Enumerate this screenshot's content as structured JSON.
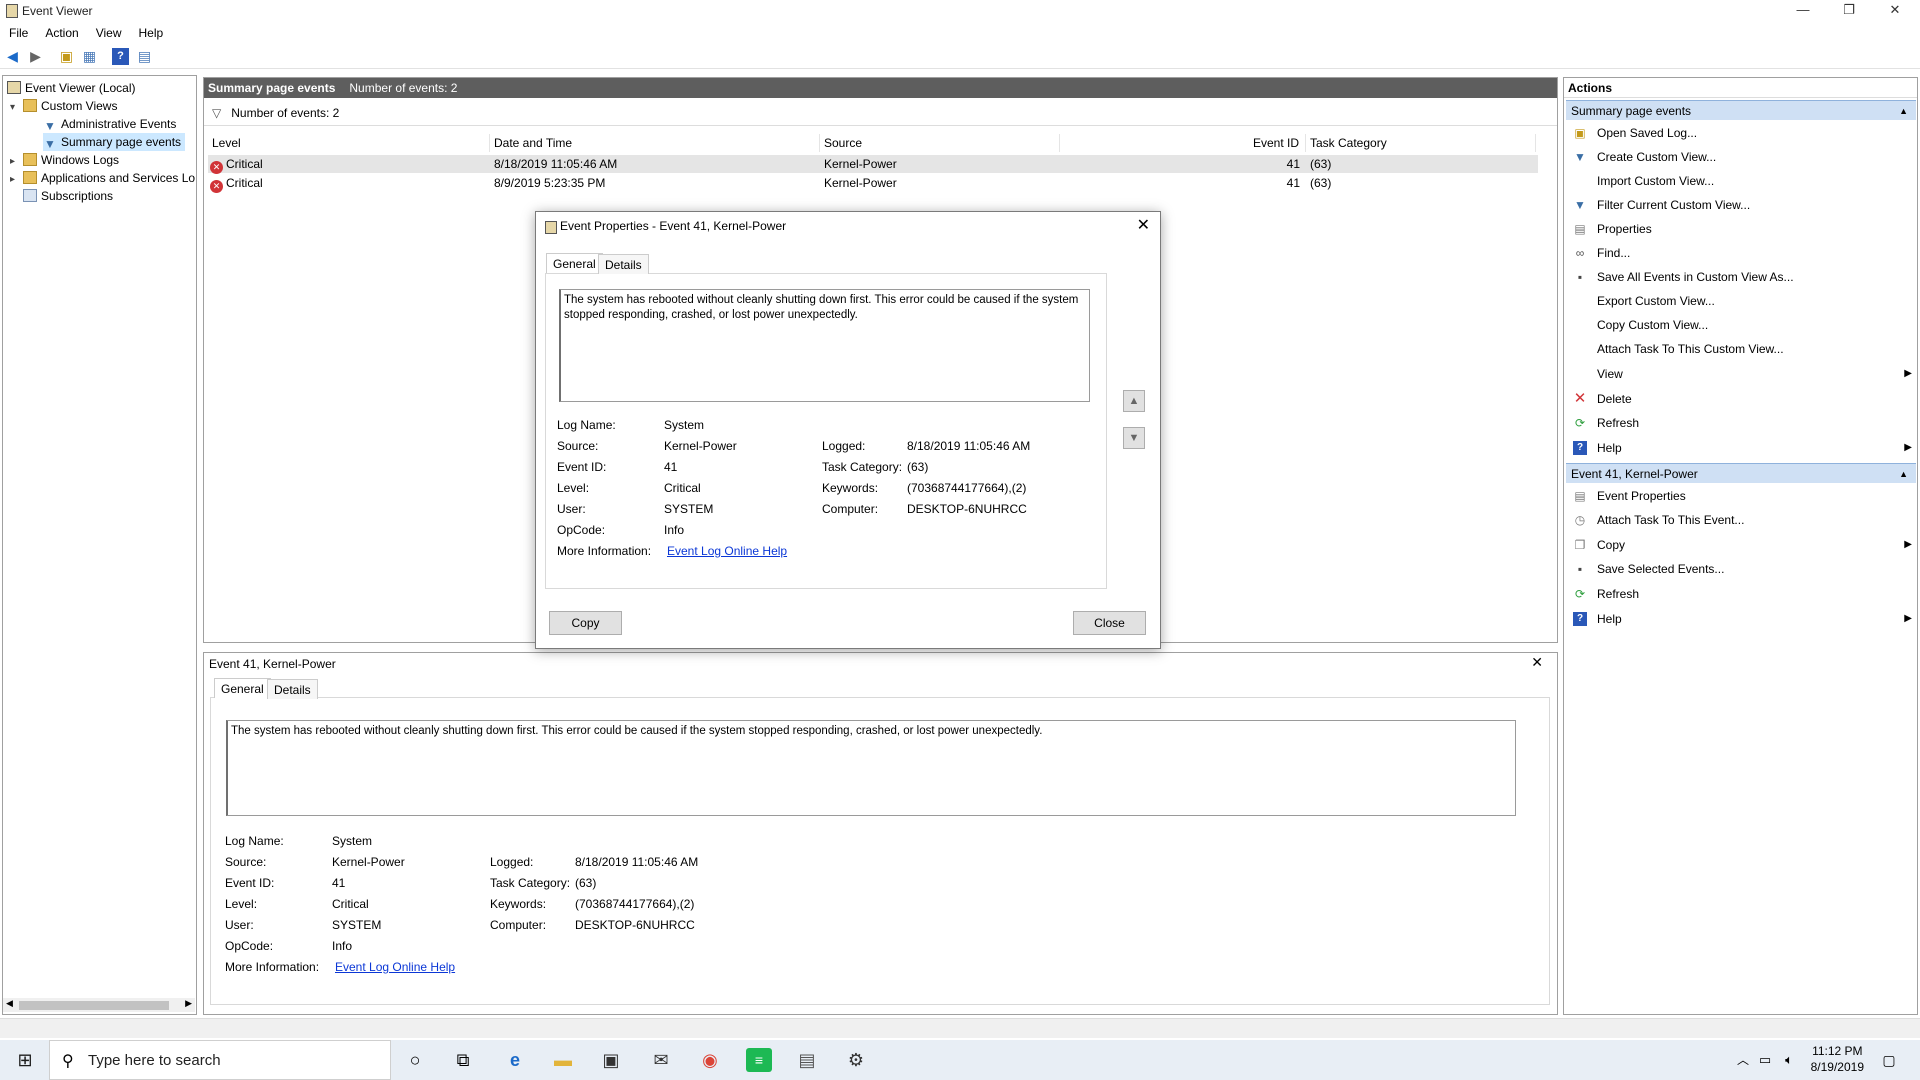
{
  "window": {
    "title": "Event Viewer"
  },
  "menu": [
    "File",
    "Action",
    "View",
    "Help"
  ],
  "tree": {
    "root": "Event Viewer (Local)",
    "custom_views": "Custom Views",
    "admin_events": "Administrative Events",
    "summary_events": "Summary page events",
    "windows_logs": "Windows Logs",
    "app_services": "Applications and Services Lo",
    "subscriptions": "Subscriptions"
  },
  "center": {
    "header_title": "Summary page events",
    "header_count": "Number of events: 2",
    "filter_text": "Number of events: 2",
    "columns": [
      "Level",
      "Date and Time",
      "Source",
      "Event ID",
      "Task Category"
    ],
    "rows": [
      {
        "level": "Critical",
        "datetime": "8/18/2019 11:05:46 AM",
        "source": "Kernel-Power",
        "event_id": "41",
        "task": "(63)"
      },
      {
        "level": "Critical",
        "datetime": "8/9/2019 5:23:35 PM",
        "source": "Kernel-Power",
        "event_id": "41",
        "task": "(63)"
      }
    ]
  },
  "event": {
    "description": "The system has rebooted without cleanly shutting down first. This error could be caused if the system stopped responding, crashed, or lost power unexpectedly.",
    "labels": {
      "log_name": "Log Name:",
      "source": "Source:",
      "event_id": "Event ID:",
      "level": "Level:",
      "user": "User:",
      "opcode": "OpCode:",
      "more_info": "More Information:",
      "logged": "Logged:",
      "task_category": "Task Category:",
      "keywords": "Keywords:",
      "computer": "Computer:"
    },
    "values": {
      "log_name": "System",
      "source": "Kernel-Power",
      "event_id": "41",
      "level": "Critical",
      "user": "SYSTEM",
      "opcode": "Info",
      "more_info_link": "Event Log Online Help",
      "logged": "8/18/2019 11:05:46 AM",
      "task_category": "(63)",
      "keywords": "(70368744177664),(2)",
      "computer": "DESKTOP-6NUHRCC"
    }
  },
  "dialog": {
    "title": "Event Properties - Event 41, Kernel-Power",
    "tab_general": "General",
    "tab_details": "Details",
    "copy_button": "Copy",
    "close_button": "Close"
  },
  "preview": {
    "title": "Event 41, Kernel-Power",
    "tab_general": "General",
    "tab_details": "Details"
  },
  "actions": {
    "title": "Actions",
    "section1": "Summary page events",
    "items1": [
      "Open Saved Log...",
      "Create Custom View...",
      "Import Custom View...",
      "Filter Current Custom View...",
      "Properties",
      "Find...",
      "Save All Events in Custom View As...",
      "Export Custom View...",
      "Copy Custom View...",
      "Attach Task To This Custom View...",
      "View",
      "Delete",
      "Refresh",
      "Help"
    ],
    "section2": "Event 41, Kernel-Power",
    "items2": [
      "Event Properties",
      "Attach Task To This Event...",
      "Copy",
      "Save Selected Events...",
      "Refresh",
      "Help"
    ]
  },
  "taskbar": {
    "search_placeholder": "Type here to search",
    "time": "11:12 PM",
    "date": "8/19/2019"
  }
}
